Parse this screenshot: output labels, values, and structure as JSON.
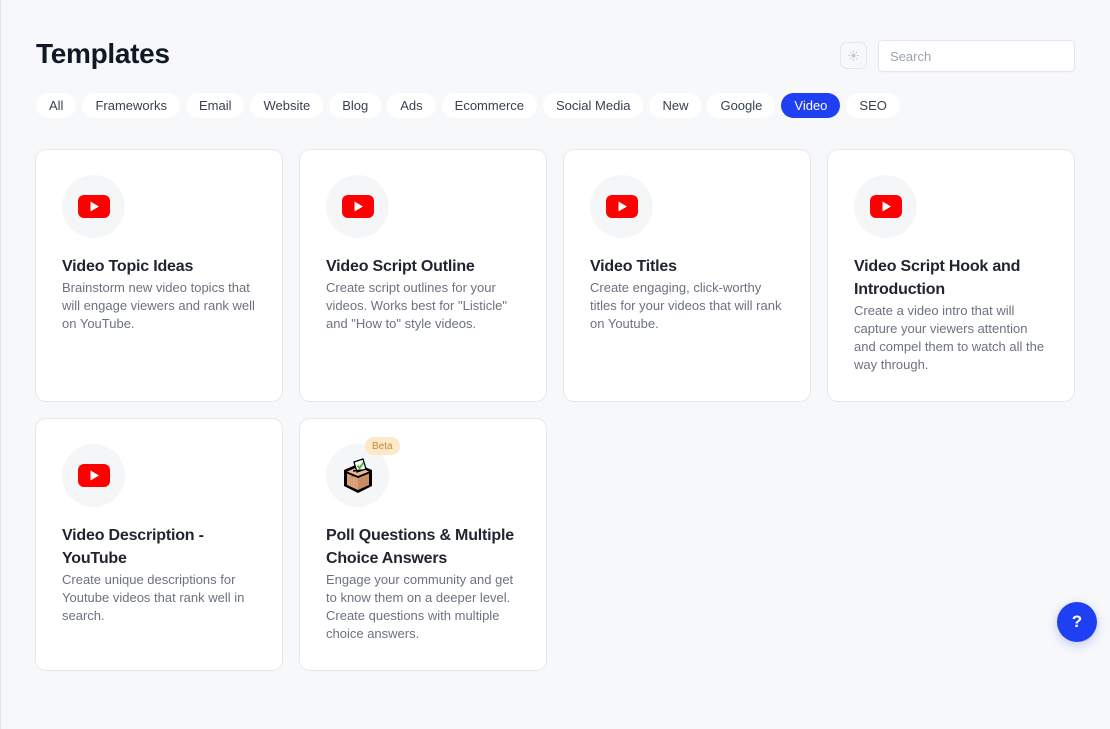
{
  "header": {
    "title": "Templates",
    "theme_toggle_icon": "sun-icon",
    "search_placeholder": "Search",
    "search_value": ""
  },
  "filters": [
    {
      "label": "All",
      "active": false
    },
    {
      "label": "Frameworks",
      "active": false
    },
    {
      "label": "Email",
      "active": false
    },
    {
      "label": "Website",
      "active": false
    },
    {
      "label": "Blog",
      "active": false
    },
    {
      "label": "Ads",
      "active": false
    },
    {
      "label": "Ecommerce",
      "active": false
    },
    {
      "label": "Social Media",
      "active": false
    },
    {
      "label": "New",
      "active": false
    },
    {
      "label": "Google",
      "active": false
    },
    {
      "label": "Video",
      "active": true
    },
    {
      "label": "SEO",
      "active": false
    }
  ],
  "templates": [
    {
      "icon": "youtube-icon",
      "title": "Video Topic Ideas",
      "description": "Brainstorm new video topics that will engage viewers and rank well on YouTube.",
      "badge": null
    },
    {
      "icon": "youtube-icon",
      "title": "Video Script Outline",
      "description": "Create script outlines for your videos. Works best for \"Listicle\" and \"How to\" style videos.",
      "badge": null
    },
    {
      "icon": "youtube-icon",
      "title": "Video Titles",
      "description": "Create engaging, click-worthy titles for your videos that will rank on Youtube.",
      "badge": null
    },
    {
      "icon": "youtube-icon",
      "title": "Video Script Hook and Introduction",
      "description": "Create a video intro that will capture your viewers attention and compel them to watch all the way through.",
      "badge": null
    },
    {
      "icon": "youtube-icon",
      "title": "Video Description - YouTube",
      "description": "Create unique descriptions for Youtube videos that rank well in search.",
      "badge": null
    },
    {
      "icon": "ballot-box-icon",
      "title": "Poll Questions & Multiple Choice Answers",
      "description": "Engage your community and get to know them on a deeper level. Create questions with multiple choice answers.",
      "badge": "Beta"
    }
  ],
  "help_button": {
    "label": "?"
  },
  "colors": {
    "accent": "#1f3ff5",
    "youtube_red": "#ff0000",
    "beta_bg": "#fde8c8",
    "beta_text": "#c2893a"
  }
}
